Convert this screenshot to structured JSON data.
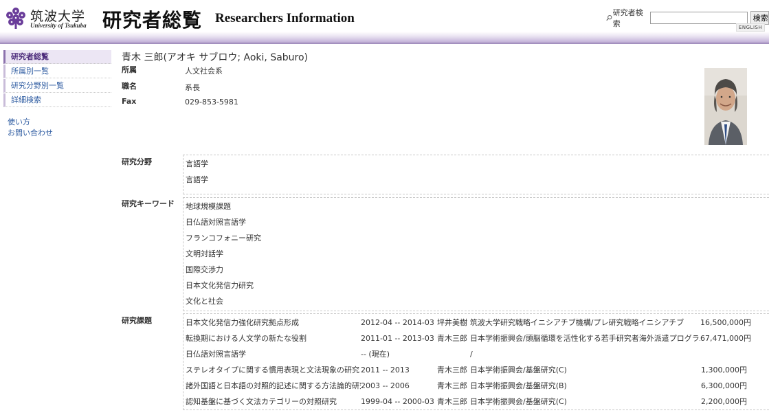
{
  "header": {
    "university_jp": "筑波大学",
    "university_en": "University of Tsukuba",
    "site_title_jp": "研究者総覧",
    "site_title_en": "Researchers Information",
    "search_label": "研究者検索",
    "search_input_value": "",
    "search_button_label": "検索",
    "english_link": "ENGLISH"
  },
  "sidebar": {
    "items": [
      {
        "label": "研究者総覧",
        "active": true
      },
      {
        "label": "所属別一覧",
        "active": false
      },
      {
        "label": "研究分野別一覧",
        "active": false
      },
      {
        "label": "詳細検索",
        "active": false
      }
    ],
    "links": [
      "使い方",
      "お問い合わせ"
    ]
  },
  "profile": {
    "name": "青木 三郎(アオキ サブロウ; Aoki, Saburo)",
    "fields": [
      {
        "label": "所属",
        "value": "人文社会系"
      },
      {
        "label": "職名",
        "value": "系長"
      },
      {
        "label": "Fax",
        "value": "029-853-5981"
      }
    ]
  },
  "research_fields": {
    "label": "研究分野",
    "items": [
      "言語学",
      "言語学"
    ]
  },
  "keywords": {
    "label": "研究キーワード",
    "items": [
      "地球規模課題",
      "日仏語対照言語学",
      "フランコフォニー研究",
      "文明対話学",
      "国際交渉力",
      "日本文化発信力研究",
      "文化と社会"
    ]
  },
  "projects": {
    "label": "研究課題",
    "rows": [
      {
        "title": "日本文化発信力強化研究拠点形成",
        "period": "2012-04 -- 2014-03",
        "person": "坪井美樹",
        "org": "筑波大学研究戦略イニシアチブ機構/プレ研究戦略イニシアチブ",
        "amount": "16,500,000円"
      },
      {
        "title": "転換期における人文学の新たな役割",
        "period": "2011-01 -- 2013-03",
        "person": "青木三郎",
        "org": "日本学術振興会/頭脳循環を活性化する若手研究者海外派遣プログラム",
        "amount": "67,471,000円"
      },
      {
        "title": "日仏語対照言語学",
        "period": "-- (現在)",
        "person": "",
        "org": "/",
        "amount": ""
      },
      {
        "title": "ステレオタイプに関する慣用表現と文法現象の研究",
        "period": "2011 -- 2013",
        "person": "青木三郎",
        "org": "日本学術振興会/基盤研究(C)",
        "amount": "1,300,000円"
      },
      {
        "title": "諸外国語と日本語の対照的記述に関する方法論的研究",
        "period": "2003 -- 2006",
        "person": "青木三郎",
        "org": "日本学術振興会/基盤研究(B)",
        "amount": "6,300,000円"
      },
      {
        "title": "認知基盤に基づく文法カテゴリーの対照研究",
        "period": "1999-04 -- 2000-03",
        "person": "青木三郎",
        "org": "日本学術振興会/基盤研究(C)",
        "amount": "2,200,000円"
      }
    ]
  },
  "colors": {
    "accent_purple": "#8c72ad",
    "link_blue": "#2c5aa0"
  }
}
